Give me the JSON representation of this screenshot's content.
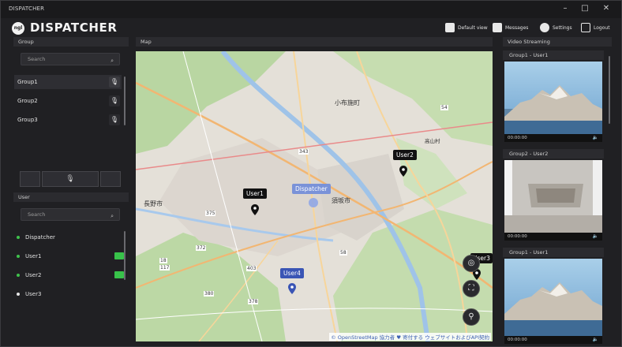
{
  "app": {
    "window_title": "DISPATCHER",
    "logo_text": "DISPATCHER",
    "logo_badge": "ngl"
  },
  "window_controls": {
    "minimize": "–",
    "maximize": "□",
    "close": "✕"
  },
  "header_buttons": [
    {
      "label": "Default view",
      "icon": "layout-icon"
    },
    {
      "label": "Messages",
      "icon": "messages-icon"
    },
    {
      "label": "Settings",
      "icon": "gear-icon"
    },
    {
      "label": "Logout",
      "icon": "logout-icon"
    }
  ],
  "group_panel": {
    "title": "Group",
    "search_placeholder": "Search",
    "groups": [
      {
        "name": "Group1",
        "selected": true,
        "mic_icon": "mic-icon"
      },
      {
        "name": "Group2",
        "selected": false,
        "mic_icon": "mic-off-icon"
      },
      {
        "name": "Group3",
        "selected": false,
        "mic_icon": "mic-off-icon"
      }
    ]
  },
  "user_panel": {
    "title": "User",
    "search_placeholder": "Search",
    "users": [
      {
        "name": "Dispatcher",
        "status_color": "#3fc24c",
        "has_camera": false
      },
      {
        "name": "User1",
        "status_color": "#3fc24c",
        "has_camera": true
      },
      {
        "name": "User2",
        "status_color": "#3fc24c",
        "has_camera": true
      },
      {
        "name": "User3",
        "status_color": "#e6e6e6",
        "has_camera": false
      }
    ]
  },
  "map_panel": {
    "title": "Map",
    "markers": [
      {
        "label": "Dispatcher",
        "style": "light"
      },
      {
        "label": "User1",
        "style": "dark"
      },
      {
        "label": "User2",
        "style": "dark"
      },
      {
        "label": "User3",
        "style": "dark"
      },
      {
        "label": "User4",
        "style": "blue"
      }
    ],
    "place_labels": [
      "長野市",
      "須坂市",
      "小布施町",
      "高山村"
    ],
    "road_numbers": [
      "343",
      "54",
      "375",
      "372",
      "18",
      "117",
      "403",
      "58",
      "380",
      "378"
    ],
    "attribution": "© OpenStreetMap 協力者 ♥ 寄付する ウェブサイトおよびAPI契約"
  },
  "video_panel": {
    "title": "Video Streaming",
    "streams": [
      {
        "title": "Group1 - User1",
        "time": "00:00:00"
      },
      {
        "title": "Group2 - User2",
        "time": "00:00:00"
      },
      {
        "title": "Group1 - User1",
        "time": "00:00:00"
      }
    ]
  },
  "colors": {
    "accent_green": "#38c24a",
    "marker_blue": "#3a55b5",
    "background": "#202023"
  }
}
